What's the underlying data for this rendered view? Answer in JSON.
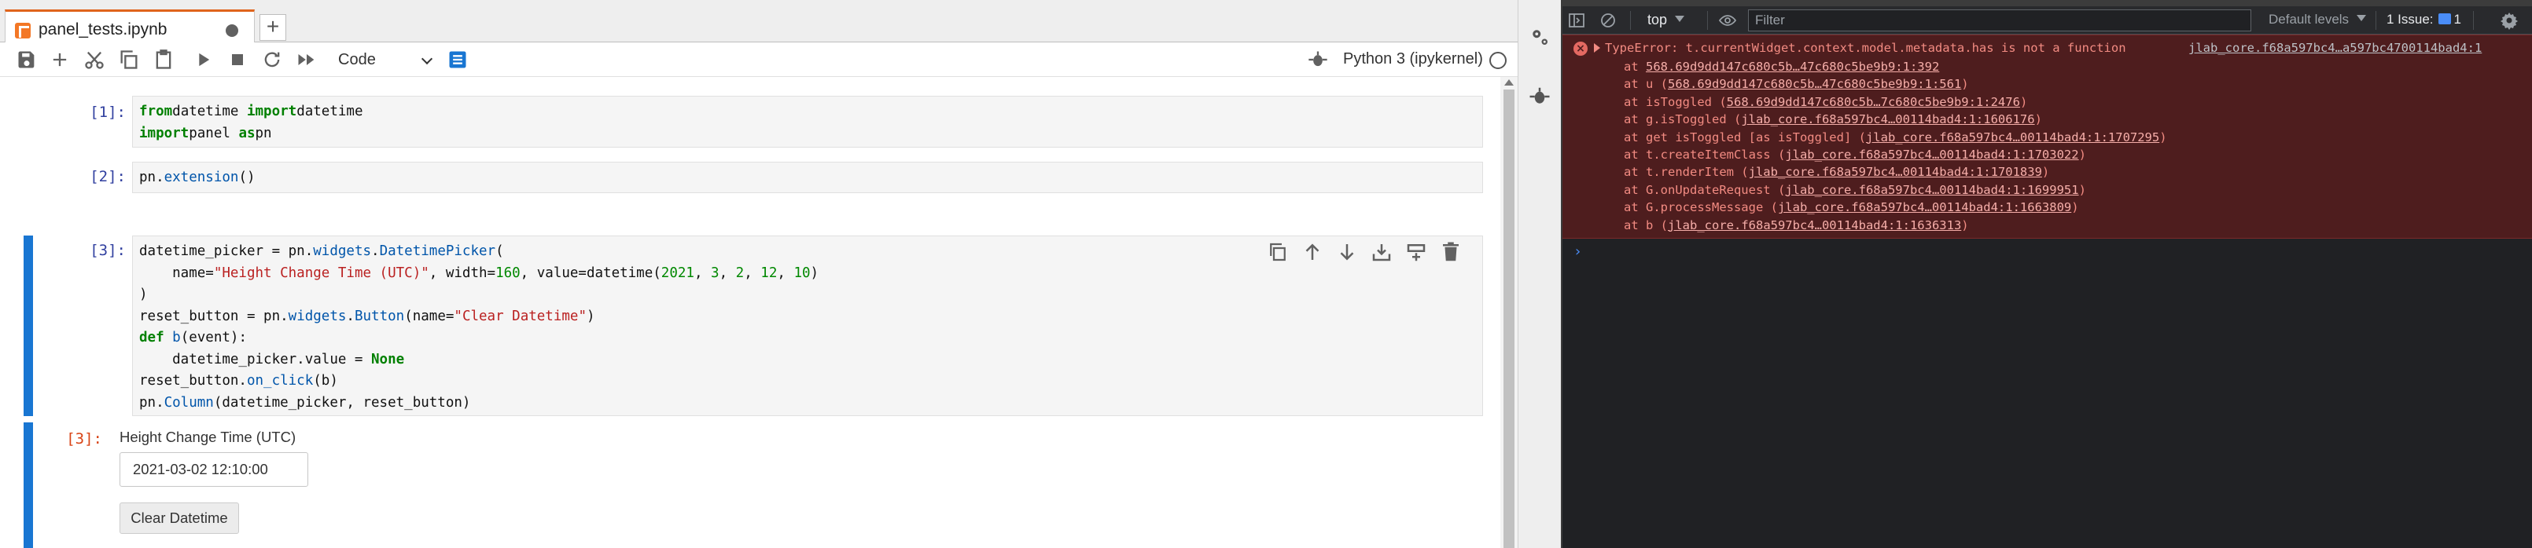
{
  "tab": {
    "title": "panel_tests.ipynb"
  },
  "toolbar": {
    "cell_type": "Code",
    "kernel_name": "Python 3 (ipykernel)"
  },
  "cells": [
    {
      "prompt": "[1]:",
      "lines": [
        [
          [
            "kw",
            "from"
          ],
          [
            "",
            "datetime "
          ],
          [
            "kw",
            "import"
          ],
          [
            "",
            "datetime"
          ]
        ],
        [
          [
            "kw",
            "import"
          ],
          [
            "",
            "panel "
          ],
          [
            "kw",
            "as"
          ],
          [
            "",
            "pn"
          ]
        ]
      ]
    },
    {
      "prompt": "[2]:",
      "lines": [
        [
          [
            "",
            "pn."
          ],
          [
            "attr",
            "extension"
          ],
          [
            "",
            "()"
          ]
        ]
      ]
    },
    {
      "prompt": "[3]:",
      "lines": [
        [
          [
            "",
            "datetime_picker = pn."
          ],
          [
            "attr",
            "widgets"
          ],
          [
            "",
            "."
          ],
          [
            "attr",
            "DatetimePicker"
          ],
          [
            "",
            "("
          ]
        ],
        [
          [
            "",
            "    name="
          ],
          [
            "str",
            "\"Height Change Time (UTC)\""
          ],
          [
            "",
            ", width="
          ],
          [
            "num",
            "160"
          ],
          [
            "",
            ", value=datetime("
          ],
          [
            "num",
            "2021"
          ],
          [
            "",
            ", "
          ],
          [
            "num",
            "3"
          ],
          [
            "",
            ", "
          ],
          [
            "num",
            "2"
          ],
          [
            "",
            ", "
          ],
          [
            "num",
            "12"
          ],
          [
            "",
            ", "
          ],
          [
            "num",
            "10"
          ],
          [
            "",
            ")"
          ]
        ],
        [
          [
            "",
            ")"
          ]
        ],
        [
          [
            "",
            "reset_button = pn."
          ],
          [
            "attr",
            "widgets"
          ],
          [
            "",
            "."
          ],
          [
            "attr",
            "Button"
          ],
          [
            "",
            "(name="
          ],
          [
            "str",
            "\"Clear Datetime\""
          ],
          [
            "",
            ")"
          ]
        ],
        [
          [
            "kw",
            "def"
          ],
          [
            "attr",
            " b"
          ],
          [
            "",
            "(event):"
          ]
        ],
        [
          [
            "",
            "    datetime_picker.value = "
          ],
          [
            "kw",
            "None"
          ]
        ],
        [
          [
            "",
            "reset_button."
          ],
          [
            "attr",
            "on_click"
          ],
          [
            "",
            "(b)"
          ]
        ],
        [
          [
            "",
            "pn."
          ],
          [
            "attr",
            "Column"
          ],
          [
            "",
            "(datetime_picker, reset_button)"
          ]
        ]
      ]
    }
  ],
  "output": {
    "prompt": "[3]:",
    "label": "Height Change Time (UTC)",
    "input_value": "2021-03-02 12:10:00",
    "button_label": "Clear Datetime"
  },
  "devtools": {
    "context": "top",
    "filter_placeholder": "Filter",
    "levels": "Default levels",
    "issues": "1 Issue:",
    "issues_count": "1",
    "error_message": "TypeError: t.currentWidget.context.model.metadata.has is not a function",
    "error_source": "jlab_core.f68a597bc4…a597bc4700114bad4:1",
    "stack": [
      {
        "fn": "at ",
        "link": "568.69d9dd147c680c5b…47c680c5be9b9:1:392",
        "tail": ""
      },
      {
        "fn": "at u (",
        "link": "568.69d9dd147c680c5b…47c680c5be9b9:1:561",
        "tail": ")"
      },
      {
        "fn": "at isToggled (",
        "link": "568.69d9dd147c680c5b…7c680c5be9b9:1:2476",
        "tail": ")"
      },
      {
        "fn": "at g.isToggled (",
        "link": "jlab_core.f68a597bc4…00114bad4:1:1606176",
        "tail": ")"
      },
      {
        "fn": "at get isToggled [as isToggled] (",
        "link": "jlab_core.f68a597bc4…00114bad4:1:1707295",
        "tail": ")"
      },
      {
        "fn": "at t.createItemClass (",
        "link": "jlab_core.f68a597bc4…00114bad4:1:1703022",
        "tail": ")"
      },
      {
        "fn": "at t.renderItem (",
        "link": "jlab_core.f68a597bc4…00114bad4:1:1701839",
        "tail": ")"
      },
      {
        "fn": "at G.onUpdateRequest (",
        "link": "jlab_core.f68a597bc4…00114bad4:1:1699951",
        "tail": ")"
      },
      {
        "fn": "at G.processMessage (",
        "link": "jlab_core.f68a597bc4…00114bad4:1:1663809",
        "tail": ")"
      },
      {
        "fn": "at b (",
        "link": "jlab_core.f68a597bc4…00114bad4:1:1636313",
        "tail": ")"
      }
    ],
    "prompt_symbol": "›"
  },
  "colors": {
    "accent": "#1976d2",
    "tab_accent": "#e0641c",
    "error_bg": "#4e1d1e",
    "error_text": "#f28b82"
  },
  "icons": [
    "notebook-icon",
    "save-icon",
    "add-icon",
    "cut-icon",
    "copy-icon",
    "paste-icon",
    "run-icon",
    "stop-icon",
    "restart-icon",
    "fast-forward-icon",
    "property-inspector-icon",
    "debugger-bug-icon",
    "gear-icon",
    "bug-icon",
    "dock-icon",
    "clear-console-icon",
    "eye-icon",
    "settings-icon",
    "duplicate-icon",
    "move-up-icon",
    "move-down-icon",
    "insert-below-icon",
    "insert-above-icon",
    "delete-icon"
  ]
}
